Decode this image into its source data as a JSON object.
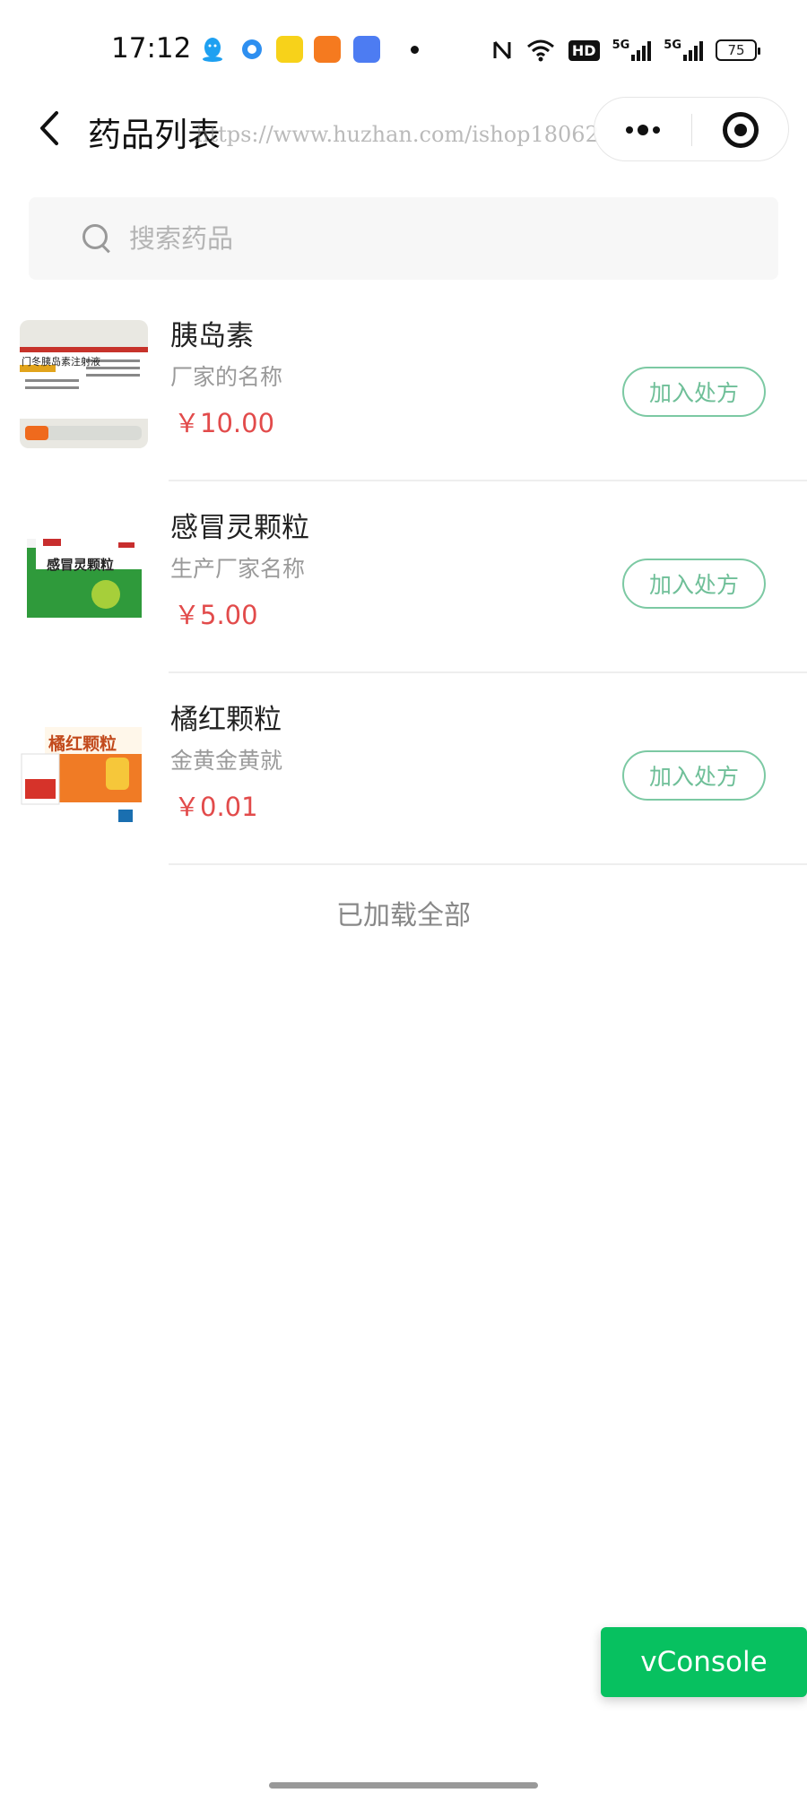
{
  "status_bar": {
    "time": "17:12",
    "network_5g_a": "5G",
    "network_5g_b": "5G",
    "hd_label": "HD",
    "battery": "75"
  },
  "nav": {
    "title": "药品列表",
    "watermark": "https://www.huzhan.com/ishop18062"
  },
  "search": {
    "placeholder": "搜索药品",
    "value": ""
  },
  "products": [
    {
      "name": "胰岛素",
      "manufacturer": "厂家的名称",
      "price": "￥10.00",
      "button": "加入处方",
      "image_text": "门冬胰岛素注射液"
    },
    {
      "name": "感冒灵颗粒",
      "manufacturer": "生产厂家名称",
      "price": "￥5.00",
      "button": "加入处方",
      "image_text": "感冒灵颗粒"
    },
    {
      "name": "橘红颗粒",
      "manufacturer": "金黄金黄就",
      "price": "￥0.01",
      "button": "加入处方",
      "image_text": "橘红颗粒"
    }
  ],
  "footer": {
    "loaded_all": "已加载全部",
    "vconsole": "vConsole"
  },
  "colors": {
    "price": "#e24b4b",
    "button_border": "#7cc9a3",
    "vconsole_bg": "#07c160"
  }
}
